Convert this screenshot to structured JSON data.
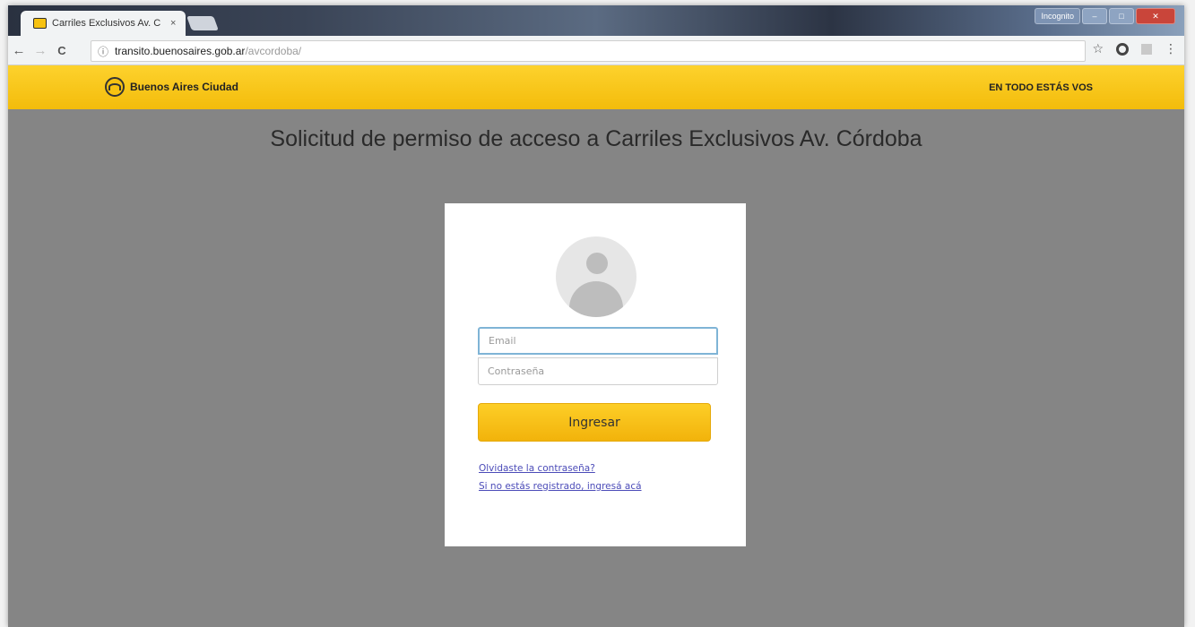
{
  "browser": {
    "tab_title": "Carriles Exclusivos Av. C",
    "tab_close": "×",
    "window_user": "Incognito",
    "url_host": "transito.buenosaires.gob.ar",
    "url_path": "/avcordoba/"
  },
  "site": {
    "brand_name": "Buenos Aires Ciudad",
    "slogan": "EN TODO ESTÁS VOS",
    "accent_color": "#f7c211"
  },
  "page": {
    "title": "Solicitud de permiso de acceso a Carriles Exclusivos Av. Córdoba"
  },
  "login": {
    "email_placeholder": "Email",
    "password_placeholder": "Contraseña",
    "submit_label": "Ingresar",
    "forgot_link": "Olvidaste la contraseña?",
    "register_link": "Si no estás registrado, ingresá acá"
  },
  "icons": {
    "back": "←",
    "forward": "→",
    "reload": "C",
    "info": "ⓘ",
    "star": "☆",
    "menu": "⋮"
  }
}
